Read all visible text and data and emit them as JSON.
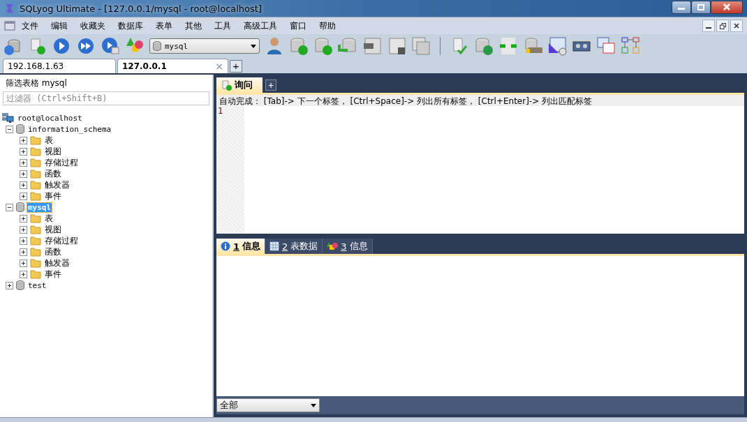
{
  "window": {
    "title": "SQLyog Ultimate - [127.0.0.1/mysql - root@localhost]"
  },
  "menu": [
    "文件",
    "编辑",
    "收藏夹",
    "数据库",
    "表单",
    "其他",
    "工具",
    "高级工具",
    "窗口",
    "帮助"
  ],
  "toolbar": {
    "database_select": "mysql"
  },
  "connection_tabs": [
    {
      "label": "192.168.1.63",
      "selected": false
    },
    {
      "label": "127.0.0.1",
      "selected": true
    }
  ],
  "connection_tab_close": "×",
  "new_connection_tab": "+",
  "filter": {
    "label": "筛选表格 mysql",
    "placeholder": "过滤器 (Ctrl+Shift+B)"
  },
  "tree": [
    {
      "kind": "server",
      "label": "root@localhost",
      "selected": false,
      "children": [
        {
          "kind": "database",
          "label": "information_schema",
          "expanded": true,
          "selected": false,
          "children": [
            {
              "kind": "folder",
              "label": "表",
              "expanded": false,
              "selected": false
            },
            {
              "kind": "folder",
              "label": "视图",
              "expanded": false,
              "selected": false
            },
            {
              "kind": "folder",
              "label": "存储过程",
              "expanded": false,
              "selected": false
            },
            {
              "kind": "folder",
              "label": "函数",
              "expanded": false,
              "selected": false
            },
            {
              "kind": "folder",
              "label": "触发器",
              "expanded": false,
              "selected": false
            },
            {
              "kind": "folder",
              "label": "事件",
              "expanded": false,
              "selected": false
            }
          ]
        },
        {
          "kind": "database",
          "label": "mysql",
          "expanded": true,
          "selected": true,
          "children": [
            {
              "kind": "folder",
              "label": "表",
              "expanded": false,
              "selected": false
            },
            {
              "kind": "folder",
              "label": "视图",
              "expanded": false,
              "selected": false
            },
            {
              "kind": "folder",
              "label": "存储过程",
              "expanded": false,
              "selected": false
            },
            {
              "kind": "folder",
              "label": "函数",
              "expanded": false,
              "selected": false
            },
            {
              "kind": "folder",
              "label": "触发器",
              "expanded": false,
              "selected": false
            },
            {
              "kind": "folder",
              "label": "事件",
              "expanded": false,
              "selected": false
            }
          ]
        },
        {
          "kind": "database",
          "label": "test",
          "expanded": false,
          "selected": false
        }
      ]
    }
  ],
  "query_tabs": [
    {
      "label": "询问",
      "selected": true
    }
  ],
  "new_query_tab": "+",
  "autocomplete_hint": "自动完成： [Tab]-> 下一个标签， [Ctrl+Space]-> 列出所有标签， [Ctrl+Enter]-> 列出匹配标签",
  "editor": {
    "line_numbers": [
      "1"
    ]
  },
  "result_tabs": [
    {
      "number": "1",
      "label": "信息",
      "selected": true
    },
    {
      "number": "2",
      "label": "表数据",
      "selected": false
    },
    {
      "number": "3",
      "label": "信息",
      "selected": false
    }
  ],
  "result_filter": {
    "value": "全部"
  }
}
